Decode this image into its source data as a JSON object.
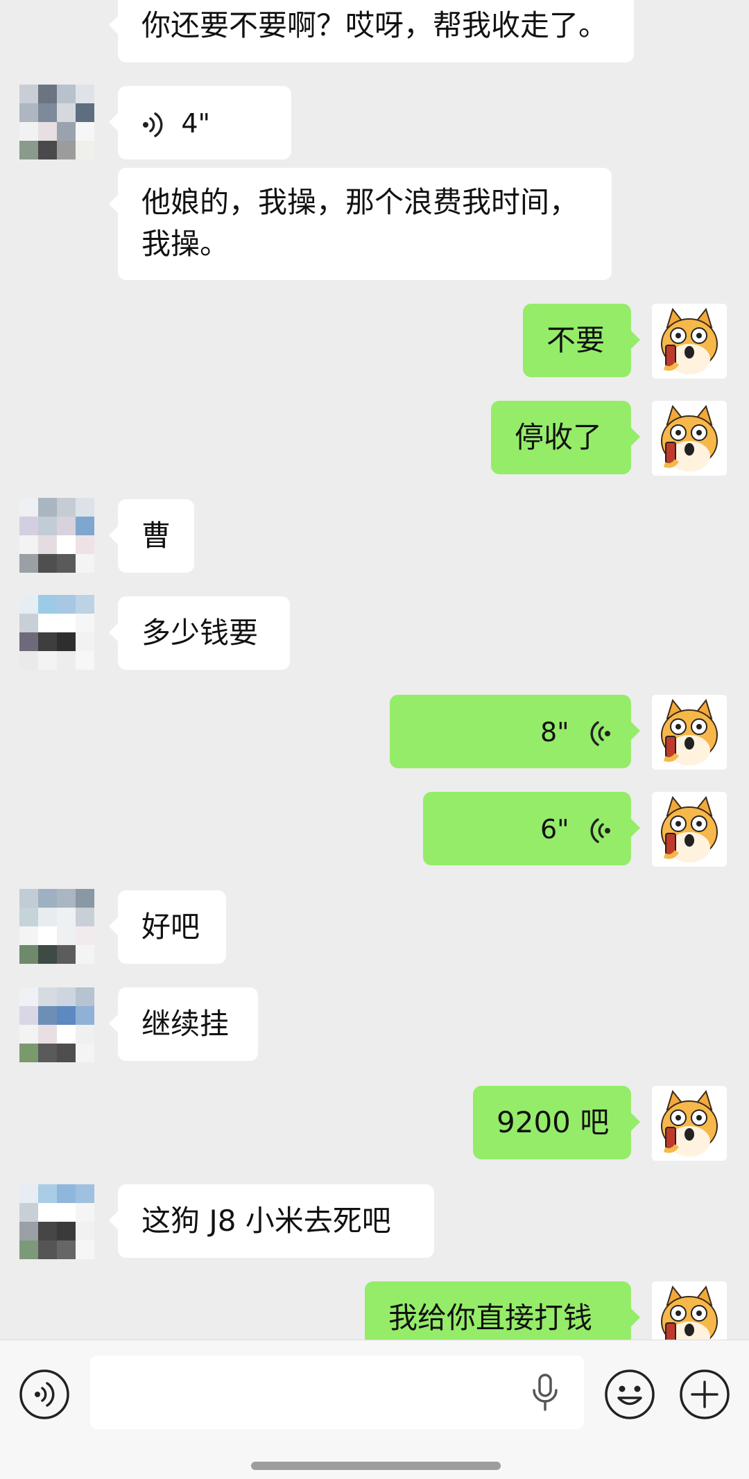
{
  "messages": [
    {
      "side": "in",
      "text": "你还要不要啊？哎呀，帮我收走了。"
    },
    {
      "side": "in",
      "type": "voice",
      "duration": "4\""
    },
    {
      "side": "in",
      "text": "他娘的，我操，那个浪费我时间，我操。"
    },
    {
      "side": "out",
      "text": "不要"
    },
    {
      "side": "out",
      "text": "停收了"
    },
    {
      "side": "in",
      "text": "曹"
    },
    {
      "side": "in",
      "text": "多少钱要"
    },
    {
      "side": "out",
      "type": "voice",
      "duration": "8\""
    },
    {
      "side": "out",
      "type": "voice",
      "duration": "6\""
    },
    {
      "side": "in",
      "text": "好吧"
    },
    {
      "side": "in",
      "text": "继续挂"
    },
    {
      "side": "out",
      "text": "9200 吧"
    },
    {
      "side": "in",
      "text": "这狗 J8 小米去死吧"
    },
    {
      "side": "out",
      "text": "我给你直接打钱"
    }
  ],
  "composer": {
    "voice_toggle_icon": "voice-mode-icon",
    "mic_icon": "microphone-icon",
    "emoji_icon": "emoji-icon",
    "more_icon": "plus-icon"
  },
  "colors": {
    "background": "#ededed",
    "incoming_bubble": "#ffffff",
    "outgoing_bubble": "#95ec69"
  }
}
